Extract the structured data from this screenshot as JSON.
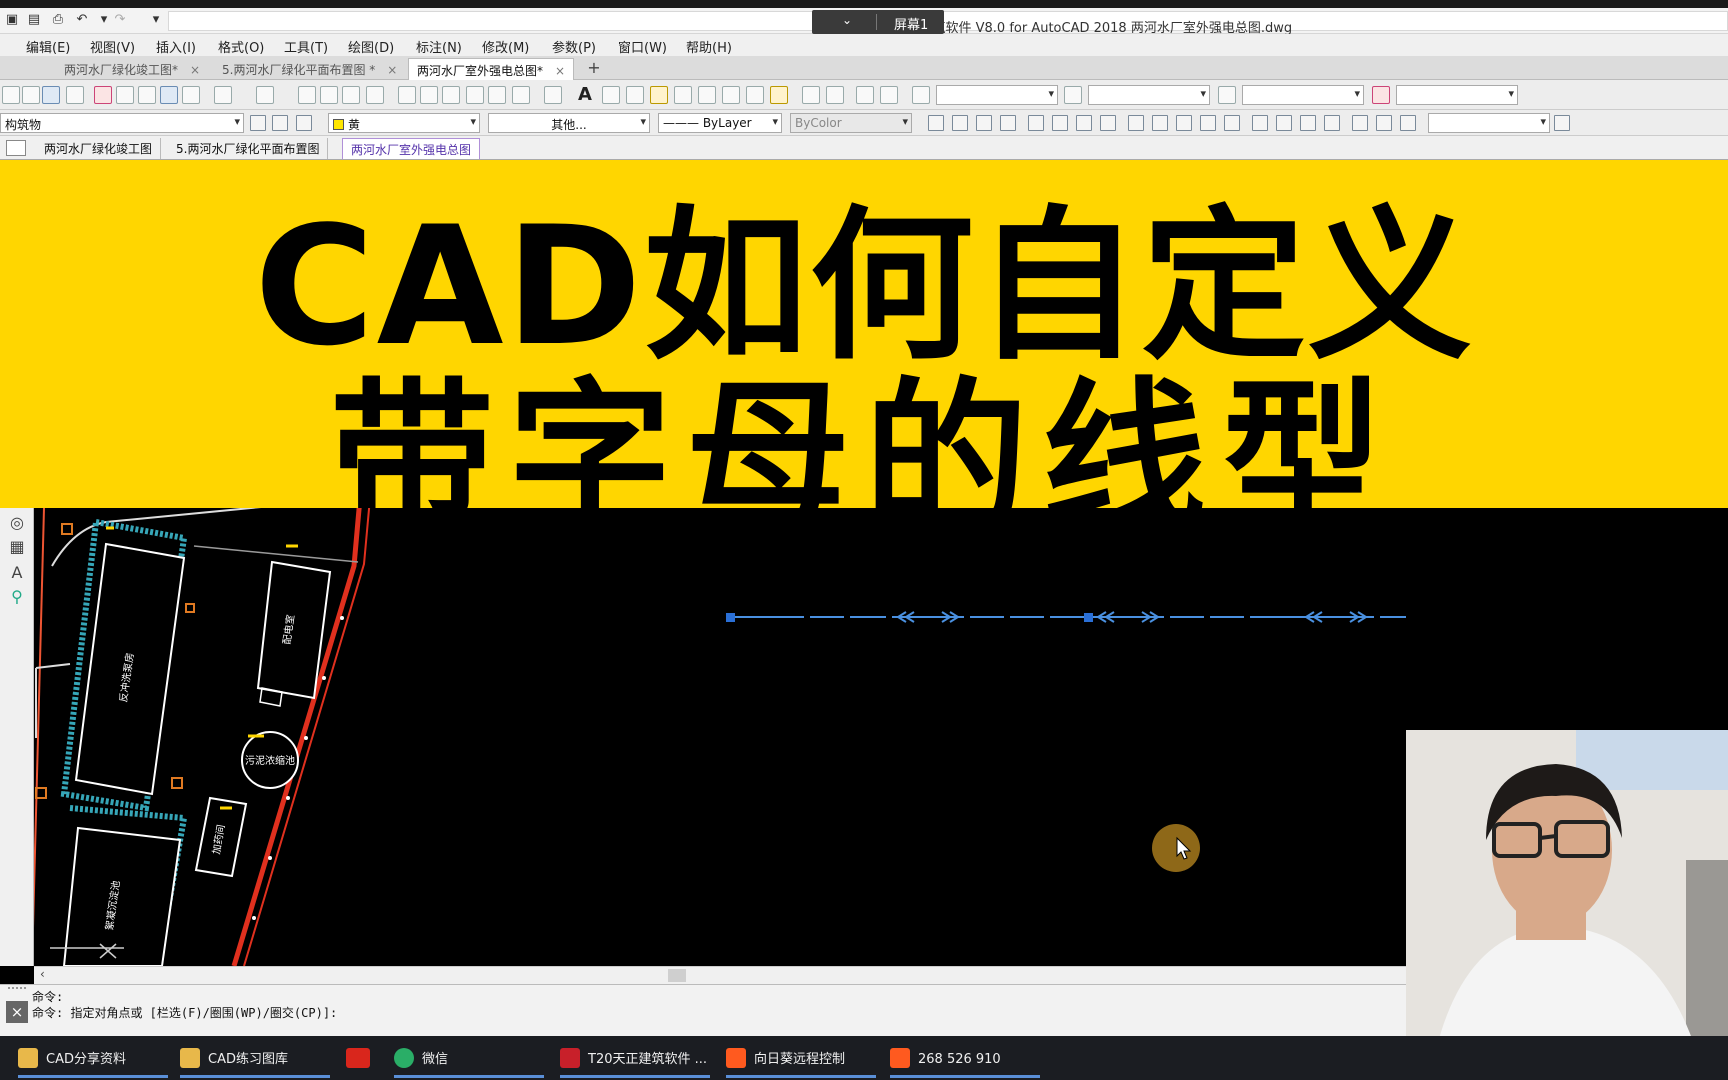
{
  "titlebar": {
    "title": "T20天正建筑软件 V8.0 for AutoCAD 2018    两河水厂室外强电总图.dwg",
    "screen_label": "屏幕1"
  },
  "menu": [
    "编辑(E)",
    "视图(V)",
    "插入(I)",
    "格式(O)",
    "工具(T)",
    "绘图(D)",
    "标注(N)",
    "修改(M)",
    "参数(P)",
    "窗口(W)",
    "帮助(H)"
  ],
  "file_tabs": [
    {
      "label": "两河水厂绿化竣工图*",
      "active": false
    },
    {
      "label": "5.两河水厂绿化平面布置图 *",
      "active": false
    },
    {
      "label": "两河水厂室外强电总图*",
      "active": true
    }
  ],
  "toolbar2": {
    "layer": "构筑物",
    "color": "黄",
    "linetype_scale": "其他...",
    "linetype": "——— ByLayer",
    "lineweight": "ByColor"
  },
  "layout_tabs": [
    {
      "label": "两河水厂绿化竣工图",
      "active": false
    },
    {
      "label": "5.两河水厂绿化平面布置图",
      "active": false
    },
    {
      "label": "两河水厂室外强电总图",
      "active": true
    }
  ],
  "banner": {
    "line1": "CAD如何自定义",
    "line2": "带字母的线型",
    "bg": "#ffd600"
  },
  "drawing_labels": {
    "building1": "反冲洗泵房",
    "building2": "配电室",
    "circle": "污泥浓缩池",
    "building3": "加药间",
    "building4": "絮凝沉淀池"
  },
  "command": {
    "line1": "命令:",
    "line2": "命令: 指定对角点或 [栏选(F)/圈围(WP)/圈交(CP)]:"
  },
  "taskbar": [
    {
      "label": "CAD分享资料",
      "icon": "folder-icon",
      "color": "#e8b84a"
    },
    {
      "label": "CAD练习图库",
      "icon": "folder-icon",
      "color": "#e8b84a"
    },
    {
      "label": "",
      "icon": "wps-icon",
      "color": "#d9261c"
    },
    {
      "label": "微信",
      "icon": "wechat-icon",
      "color": "#2aae67"
    },
    {
      "label": "T20天正建筑软件 ...",
      "icon": "autocad-icon",
      "color": "#c8202a"
    },
    {
      "label": "向日葵远程控制",
      "icon": "sunflower-icon",
      "color": "#ff5a1f"
    },
    {
      "label": "268 526 910",
      "icon": "sunflower-icon",
      "color": "#ff5a1f"
    }
  ]
}
